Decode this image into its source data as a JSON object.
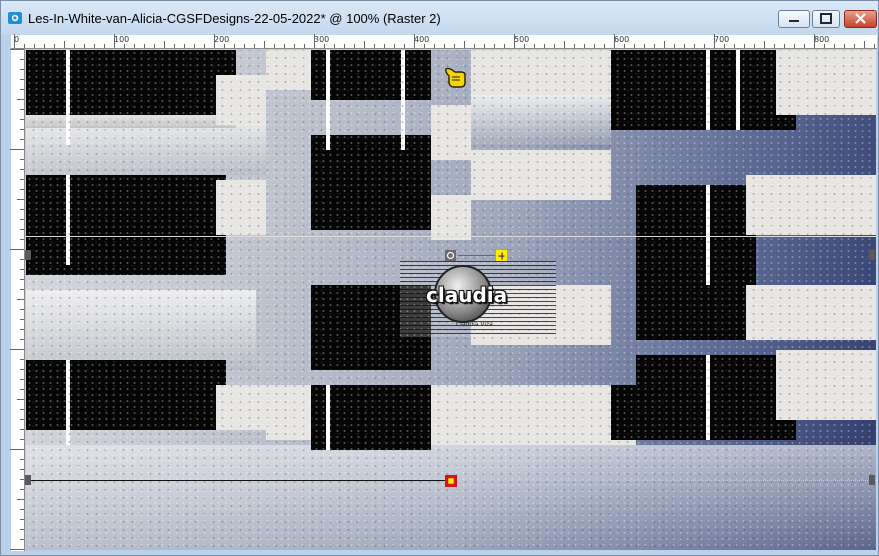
{
  "window": {
    "title": "Les-In-White-van-Alicia-CGSFDesigns-22-05-2022* @ 100% (Raster 2)",
    "controls": [
      "minimize",
      "maximize",
      "close"
    ]
  },
  "ruler": {
    "labels": [
      "0",
      "100",
      "200",
      "300",
      "400",
      "500",
      "600",
      "700",
      "800"
    ]
  },
  "canvas": {
    "layer_name": "Raster 2",
    "zoom": "100%"
  },
  "watermark": {
    "text": "claudia",
    "subtext": "Claudia Viza"
  },
  "icons": {
    "app": "paintshop-icon",
    "pointer": "hand-pointer-icon",
    "rotate_handle": "rotate-handle-icon",
    "move_handle": "move-handle-icon"
  },
  "colors": {
    "titlebar": "#c3d8ee",
    "guide_line": "#111111",
    "guide_dotted": "#e8e000",
    "handle_yellow": "#ffee00",
    "handle_red": "#d31515"
  }
}
